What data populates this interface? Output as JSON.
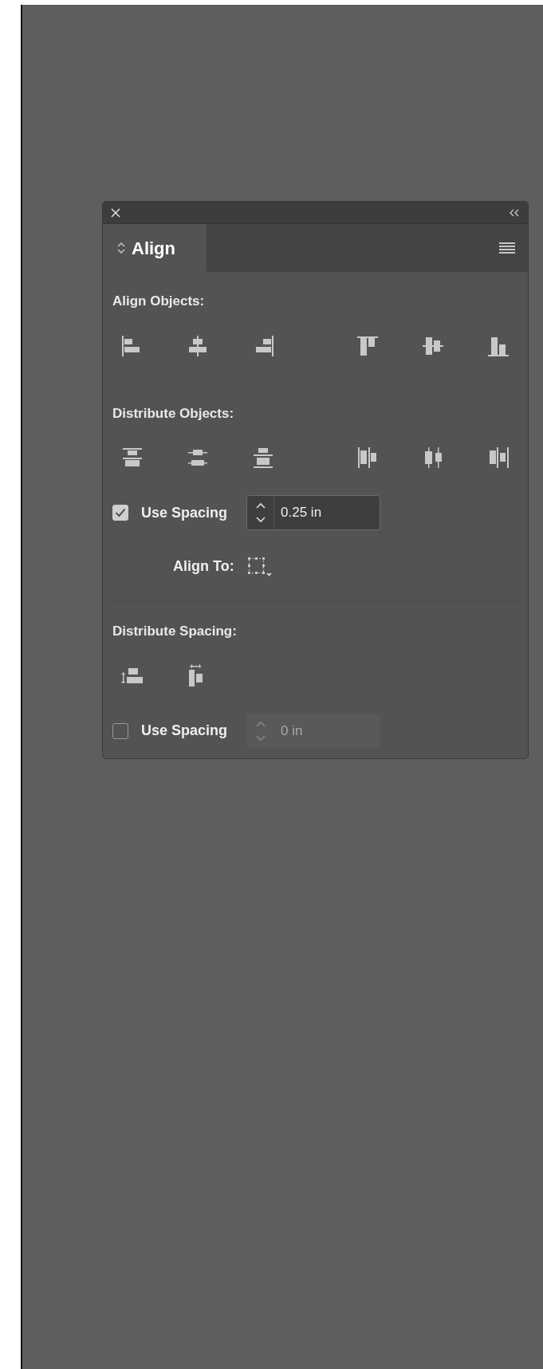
{
  "panel": {
    "tabs": [
      {
        "label": "Align",
        "selected": true
      }
    ],
    "sections": [
      {
        "title": "Align Objects:"
      },
      {
        "title": "Distribute Objects:",
        "use_spacing": {
          "label": "Use Spacing",
          "checked": true,
          "value": "0.25 in",
          "disabled": false
        },
        "align_to": {
          "label": "Align To:"
        }
      },
      {
        "title": "Distribute Spacing:",
        "use_spacing": {
          "label": "Use Spacing",
          "checked": false,
          "value": "0 in",
          "disabled": true
        }
      }
    ]
  }
}
